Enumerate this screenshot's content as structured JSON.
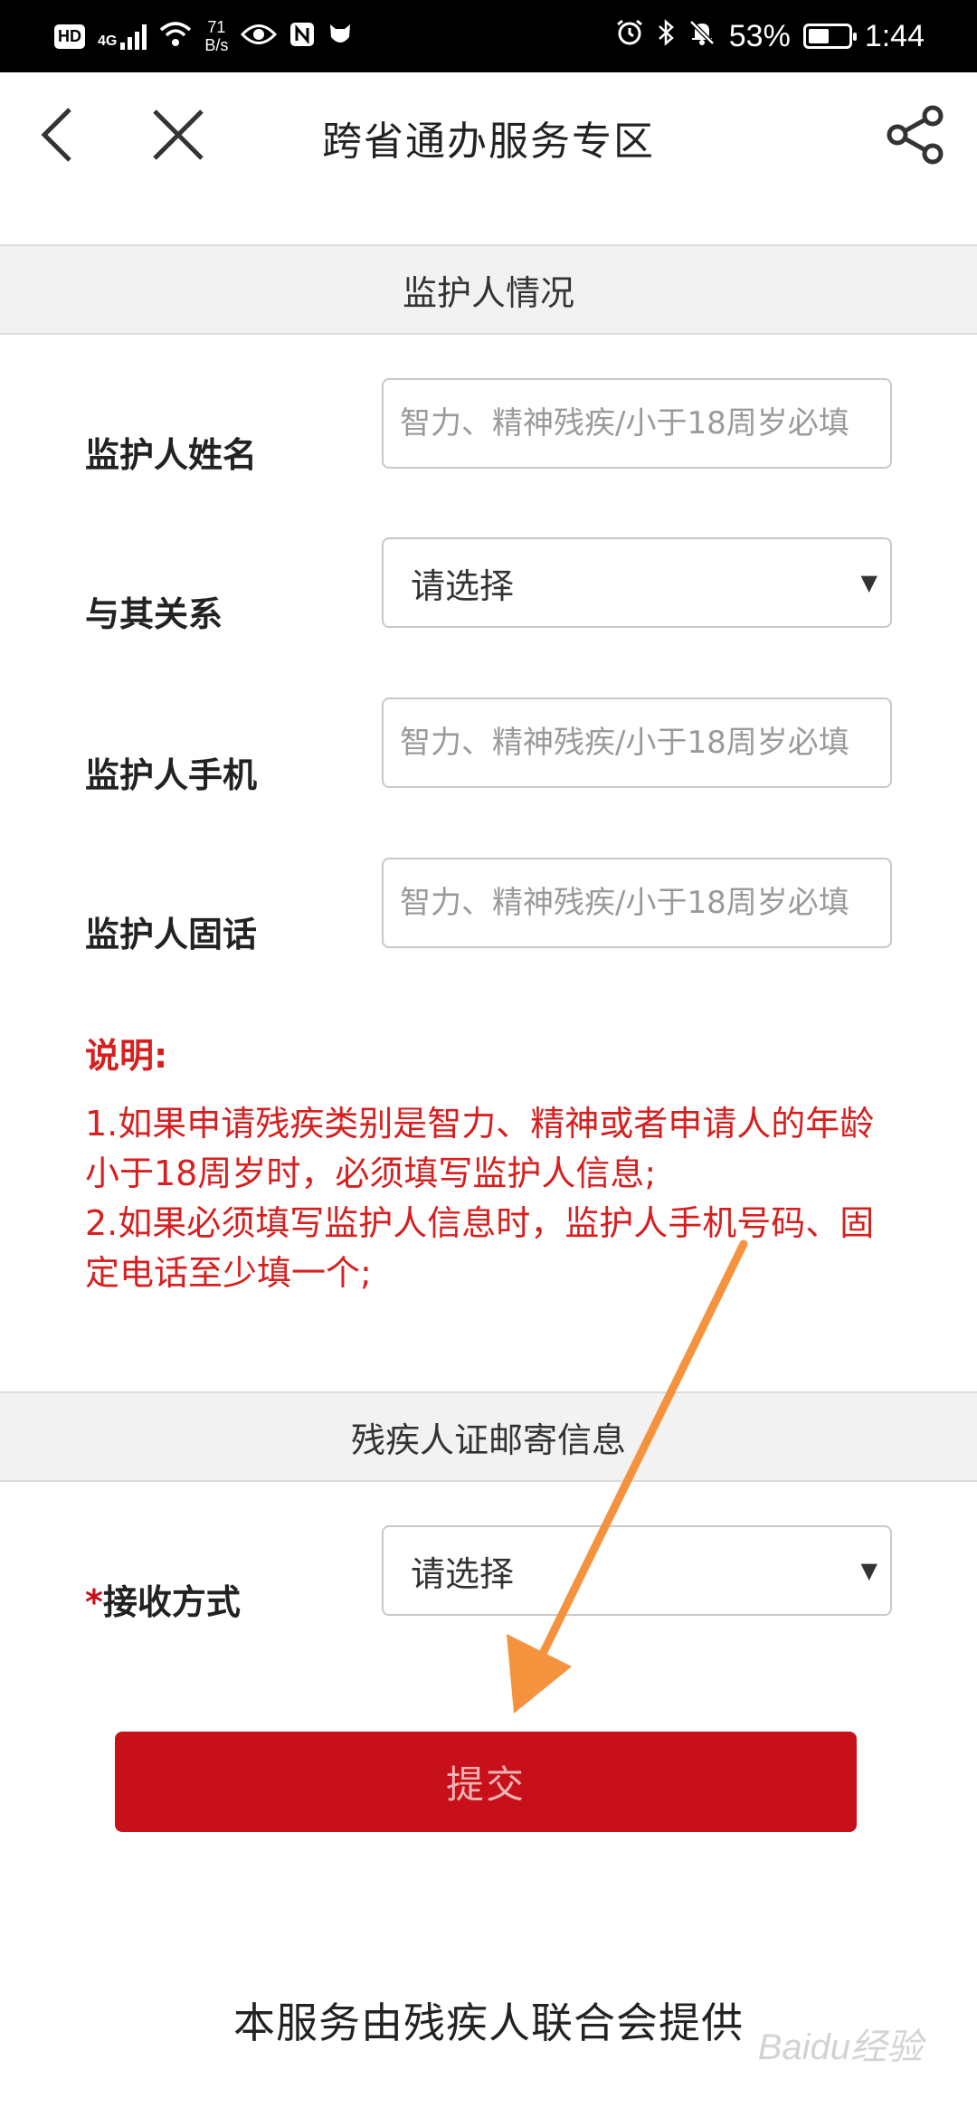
{
  "status_bar": {
    "hd": "HD",
    "net_type": "4G",
    "speed_value": "71",
    "speed_unit": "B/s",
    "battery_text": "53%",
    "battery_level": 0.53,
    "time": "1:44"
  },
  "header": {
    "title": "跨省通办服务专区"
  },
  "guardian_section": {
    "title": "监护人情况",
    "fields": [
      {
        "label": "监护人姓名",
        "placeholder": "智力、精神残疾/小于18周岁必填",
        "value": ""
      },
      {
        "label": "与其关系",
        "selected": "请选择"
      },
      {
        "label": "监护人手机",
        "placeholder": "智力、精神残疾/小于18周岁必填",
        "value": ""
      },
      {
        "label": "监护人固话",
        "placeholder": "智力、精神残疾/小于18周岁必填",
        "value": ""
      }
    ]
  },
  "notes": {
    "title": "说明:",
    "line1": "1.如果申请残疾类别是智力、精神或者申请人的年龄小于18周岁时，必须填写监护人信息;",
    "line2": "2.如果必须填写监护人信息时，监护人手机号码、固定电话至少填一个;"
  },
  "mail_section": {
    "title": "残疾人证邮寄信息",
    "required_mark": "*",
    "field_label": "接收方式",
    "selected": "请选择"
  },
  "submit_label": "提交",
  "footer_text": "本服务由残疾人联合会提供",
  "watermark_text": "Baidu经验",
  "colors": {
    "accent_red": "#c8101a",
    "note_red": "#d61f1f",
    "annotation_arrow": "#f5923e"
  },
  "caret_glyph": "▼"
}
